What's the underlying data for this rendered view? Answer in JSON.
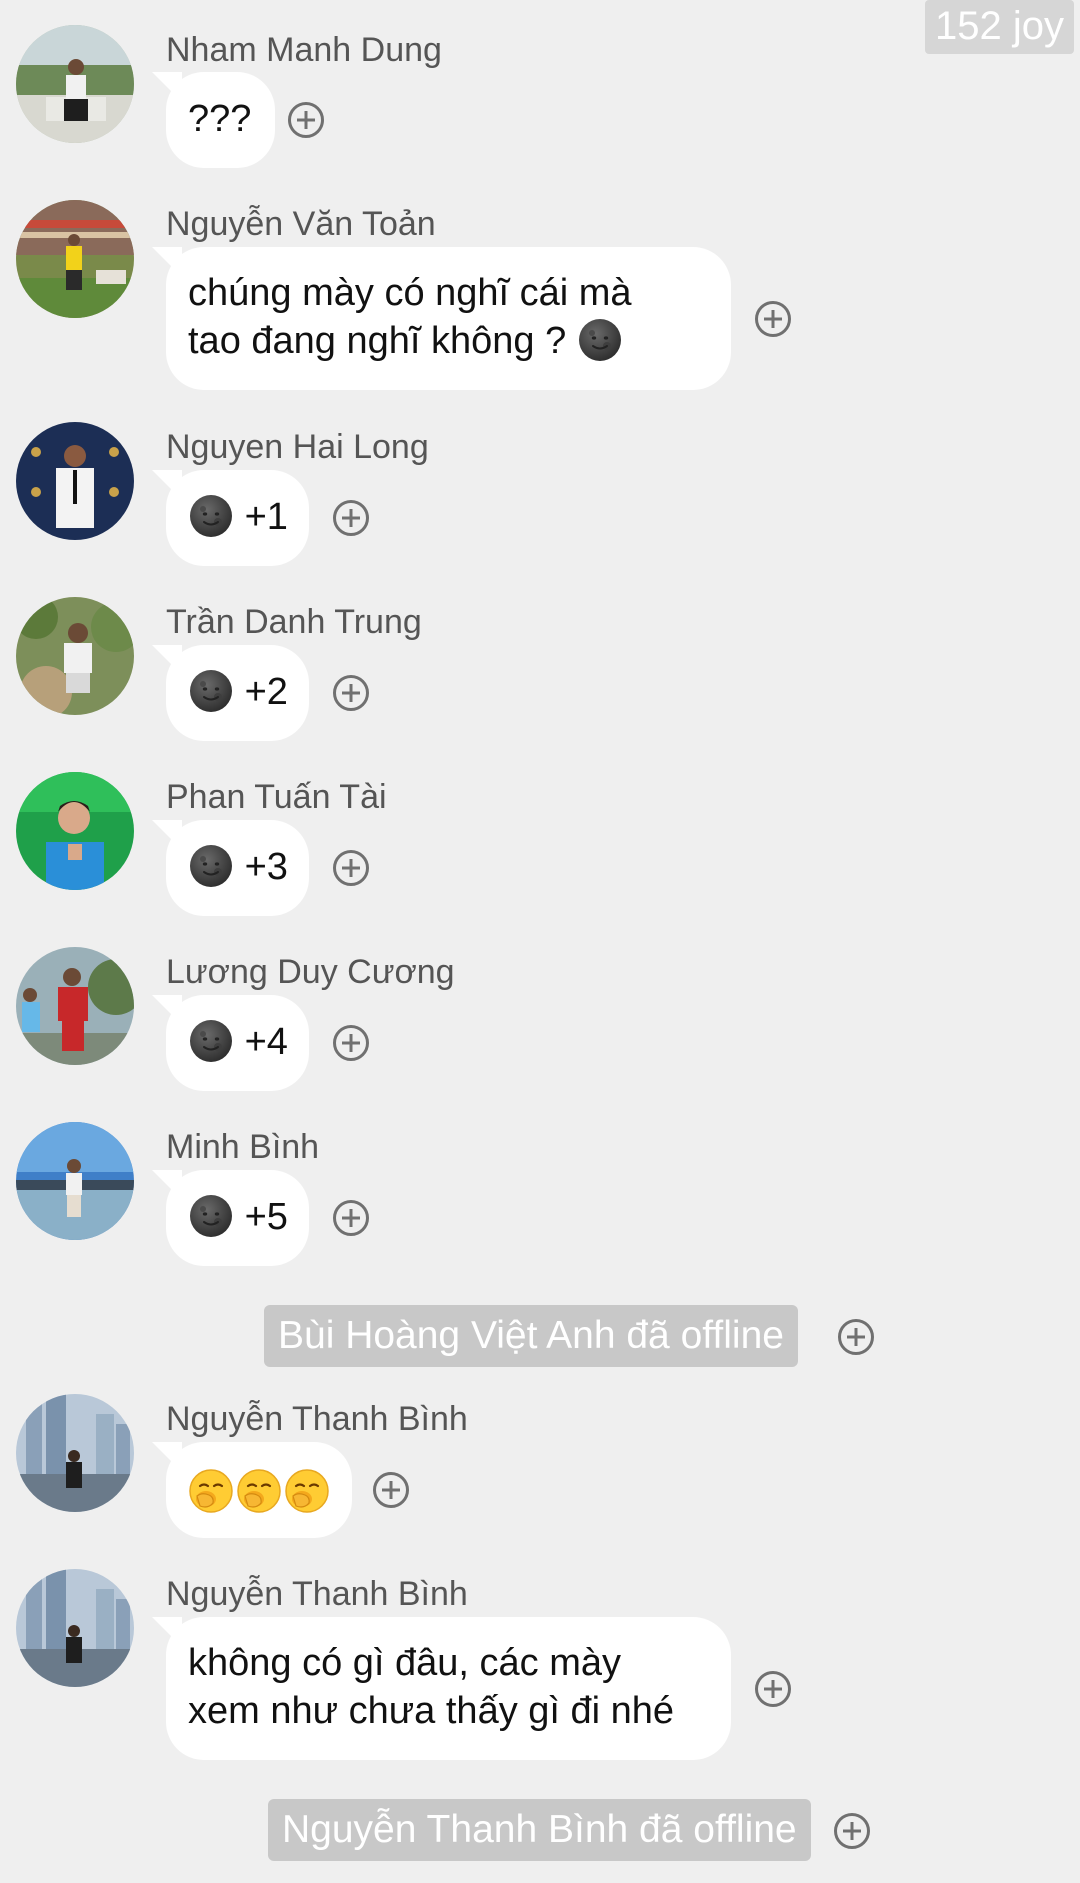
{
  "watermark": "152 joy",
  "messages": [
    {
      "sender": "Nham Manh Dung",
      "text": "???"
    },
    {
      "sender": "Nguyễn Văn Toản",
      "line1": "chúng mày có nghĩ cái mà",
      "line2": "tao đang nghĩ không ?"
    },
    {
      "sender": "Nguyen Hai Long",
      "text": "+1"
    },
    {
      "sender": "Trần Danh Trung",
      "text": "+2"
    },
    {
      "sender": "Phan Tuấn Tài",
      "text": "+3"
    },
    {
      "sender": "Lương Duy Cương",
      "text": "+4"
    },
    {
      "sender": "Minh Bình",
      "text": "+5"
    },
    {
      "sender": "Nguyễn Thanh Bình",
      "emoji_count": 3
    },
    {
      "sender": "Nguyễn Thanh Bình",
      "line1": "không có gì đâu, các mày",
      "line2": "xem như chưa thấy gì đi nhé"
    }
  ],
  "notices": [
    "Bùi Hoàng Việt Anh đã offline",
    "Nguyễn Thanh Bình đã offline"
  ],
  "icons": {
    "react": "plus-circle-icon",
    "emoji_moon": "new-moon-face-icon",
    "emoji_yawn": "yawning-face-icon"
  }
}
